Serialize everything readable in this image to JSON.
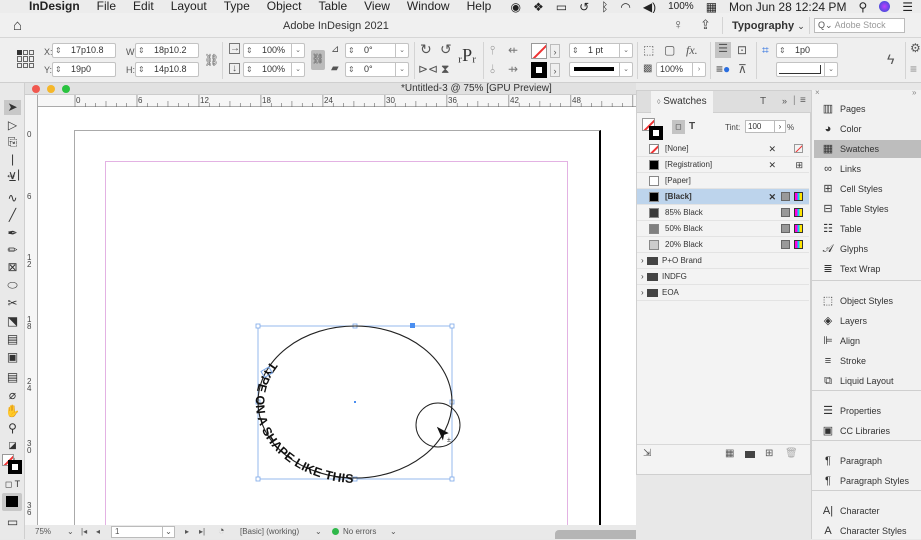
{
  "menubar": {
    "apple_icon": "apple-icon",
    "app_name": "InDesign",
    "items": [
      "File",
      "Edit",
      "Layout",
      "Type",
      "Object",
      "Table",
      "View",
      "Window",
      "Help"
    ],
    "battery": "100%",
    "clock": "Mon Jun 28  12:24 PM"
  },
  "appbar": {
    "title": "Adobe InDesign 2021",
    "workspace": "Typography",
    "stock_placeholder": "Adobe Stock"
  },
  "control": {
    "x_label": "X:",
    "x_value": "17p10.8",
    "y_label": "Y:",
    "y_value": "19p0",
    "w_label": "W:",
    "w_value": "18p10.2",
    "h_label": "H:",
    "h_value": "14p10.8",
    "scale_x": "100%",
    "scale_y": "100%",
    "rotate": "0°",
    "shear": "0°",
    "stroke_weight": "1 pt",
    "opacity": "100%",
    "offset": "1p0"
  },
  "document": {
    "title": "*Untitled-3 @ 75% [GPU Preview]",
    "h_ruler": [
      "0",
      "6",
      "12",
      "18",
      "24",
      "30",
      "36",
      "42",
      "48"
    ],
    "v_ruler": [
      "0",
      "6",
      "1 2",
      "1 8",
      "2 4",
      "3 0",
      "3 6"
    ],
    "path_text": "TYPE ON A SHAPE LIKE THIS"
  },
  "status": {
    "zoom": "75%",
    "page": "1",
    "preflight_profile": "[Basic] (working)",
    "errors": "No errors"
  },
  "swatches": {
    "tab_label": "Swatches",
    "tint_label": "Tint:",
    "tint_value": "100",
    "tint_unit": "%",
    "items": [
      {
        "name": "[None]",
        "color": "none"
      },
      {
        "name": "[Registration]",
        "color": "#000000"
      },
      {
        "name": "[Paper]",
        "color": "#ffffff"
      },
      {
        "name": "[Black]",
        "color": "#000000",
        "selected": true
      },
      {
        "name": "85% Black",
        "color": "#3a3a3a"
      },
      {
        "name": "50% Black",
        "color": "#808080"
      },
      {
        "name": "20% Black",
        "color": "#cccccc"
      }
    ],
    "groups": [
      "P+O Brand",
      "INDFG",
      "EOA"
    ]
  },
  "dock": {
    "items": [
      {
        "label": "Pages",
        "icon": "pages-icon",
        "glyph": "▥"
      },
      {
        "label": "Color",
        "icon": "color-icon",
        "glyph": "◕"
      },
      {
        "label": "Swatches",
        "icon": "swatches-icon",
        "glyph": "▦",
        "selected": true
      },
      {
        "label": "Links",
        "icon": "links-icon",
        "glyph": "∞"
      },
      {
        "label": "Cell Styles",
        "icon": "cell-styles-icon",
        "glyph": "⊞"
      },
      {
        "label": "Table Styles",
        "icon": "table-styles-icon",
        "glyph": "⊟"
      },
      {
        "label": "Table",
        "icon": "table-icon",
        "glyph": "☷"
      },
      {
        "label": "Glyphs",
        "icon": "glyphs-icon",
        "glyph": "𝒜"
      },
      {
        "label": "Text Wrap",
        "icon": "text-wrap-icon",
        "glyph": "≣"
      },
      {
        "label": "Object Styles",
        "icon": "object-styles-icon",
        "glyph": "⬚"
      },
      {
        "label": "Layers",
        "icon": "layers-icon",
        "glyph": "◈"
      },
      {
        "label": "Align",
        "icon": "align-icon",
        "glyph": "⊫"
      },
      {
        "label": "Stroke",
        "icon": "stroke-icon",
        "glyph": "≡"
      },
      {
        "label": "Liquid Layout",
        "icon": "liquid-layout-icon",
        "glyph": "⧉"
      },
      {
        "label": "Properties",
        "icon": "properties-icon",
        "glyph": "☰"
      },
      {
        "label": "CC Libraries",
        "icon": "cc-libraries-icon",
        "glyph": "▣"
      },
      {
        "label": "Paragraph",
        "icon": "paragraph-icon",
        "glyph": "¶"
      },
      {
        "label": "Paragraph Styles",
        "icon": "paragraph-styles-icon",
        "glyph": "¶"
      },
      {
        "label": "Character",
        "icon": "character-icon",
        "glyph": "A|"
      },
      {
        "label": "Character Styles",
        "icon": "character-styles-icon",
        "glyph": "A"
      }
    ]
  },
  "colors": {
    "accent": "#4a8ef0",
    "margin_guide": "#e3b2e3",
    "selection_row": "#bdd4ec",
    "no_errors": "#2fb84a"
  }
}
